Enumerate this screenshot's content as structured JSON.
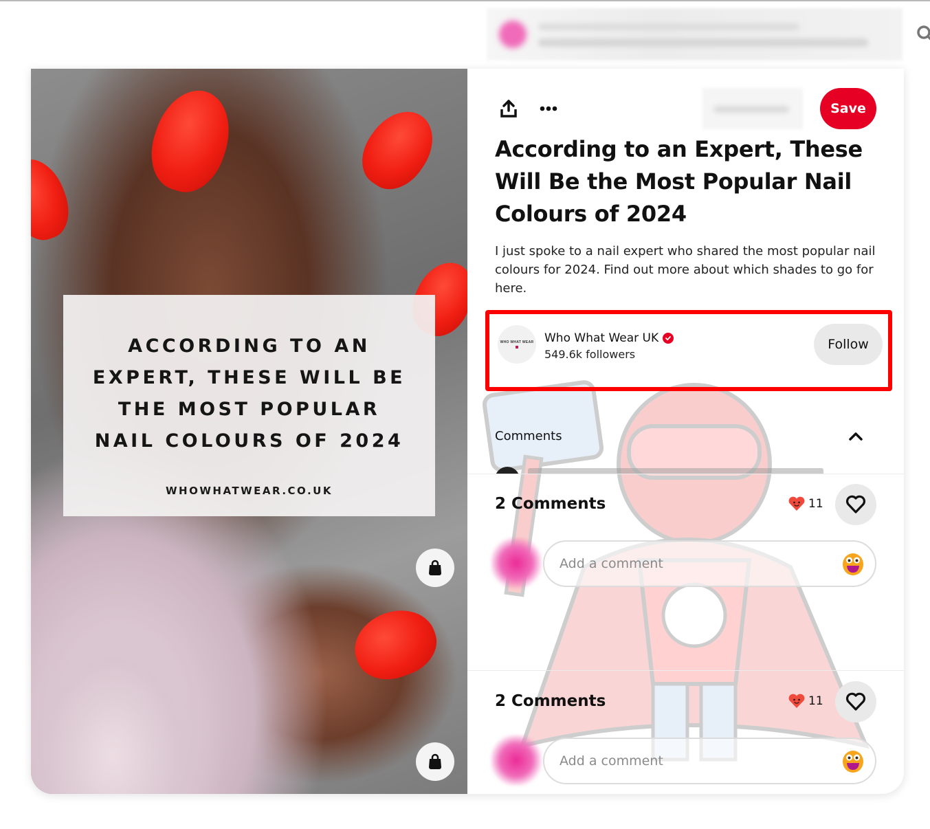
{
  "header": {
    "search_icon": "search-icon"
  },
  "pin_image": {
    "overlay_title": "ACCORDING TO AN EXPERT, THESE WILL BE THE MOST POPULAR NAIL COLOURS OF 2024",
    "overlay_lines": [
      "ACCORDING TO AN",
      "EXPERT, THESE WILL BE",
      "THE MOST POPULAR",
      "NAIL COLOURS OF 2024"
    ],
    "overlay_url": "WHOWHATWEAR.CO.UK",
    "shop_buttons": [
      "shopping-bag-icon",
      "shopping-bag-icon"
    ]
  },
  "toolbar": {
    "share_icon": "share-icon",
    "more_icon": "more-options-icon",
    "save_label": "Save",
    "save_color": "#e60023"
  },
  "pin": {
    "title": "According to an Expert, These Will Be the Most Popular Nail Colours of 2024",
    "description": "I just spoke to a nail expert who shared the most popular nail colours for 2024. Find out more about which shades to go for here."
  },
  "creator": {
    "avatar_text": "WHO WHAT WEAR",
    "name": "Who What Wear UK",
    "verified": true,
    "followers": "549.6k followers",
    "follow_label": "Follow",
    "highlight_color": "#ff0000"
  },
  "comments_section": {
    "heading": "Comments",
    "collapse_icon": "chevron-up-icon"
  },
  "comment_blocks": [
    {
      "count_label": "2 Comments",
      "reaction_count": "11",
      "placeholder": "Add a comment"
    },
    {
      "count_label": "2 Comments",
      "reaction_count": "11",
      "placeholder": "Add a comment"
    }
  ]
}
